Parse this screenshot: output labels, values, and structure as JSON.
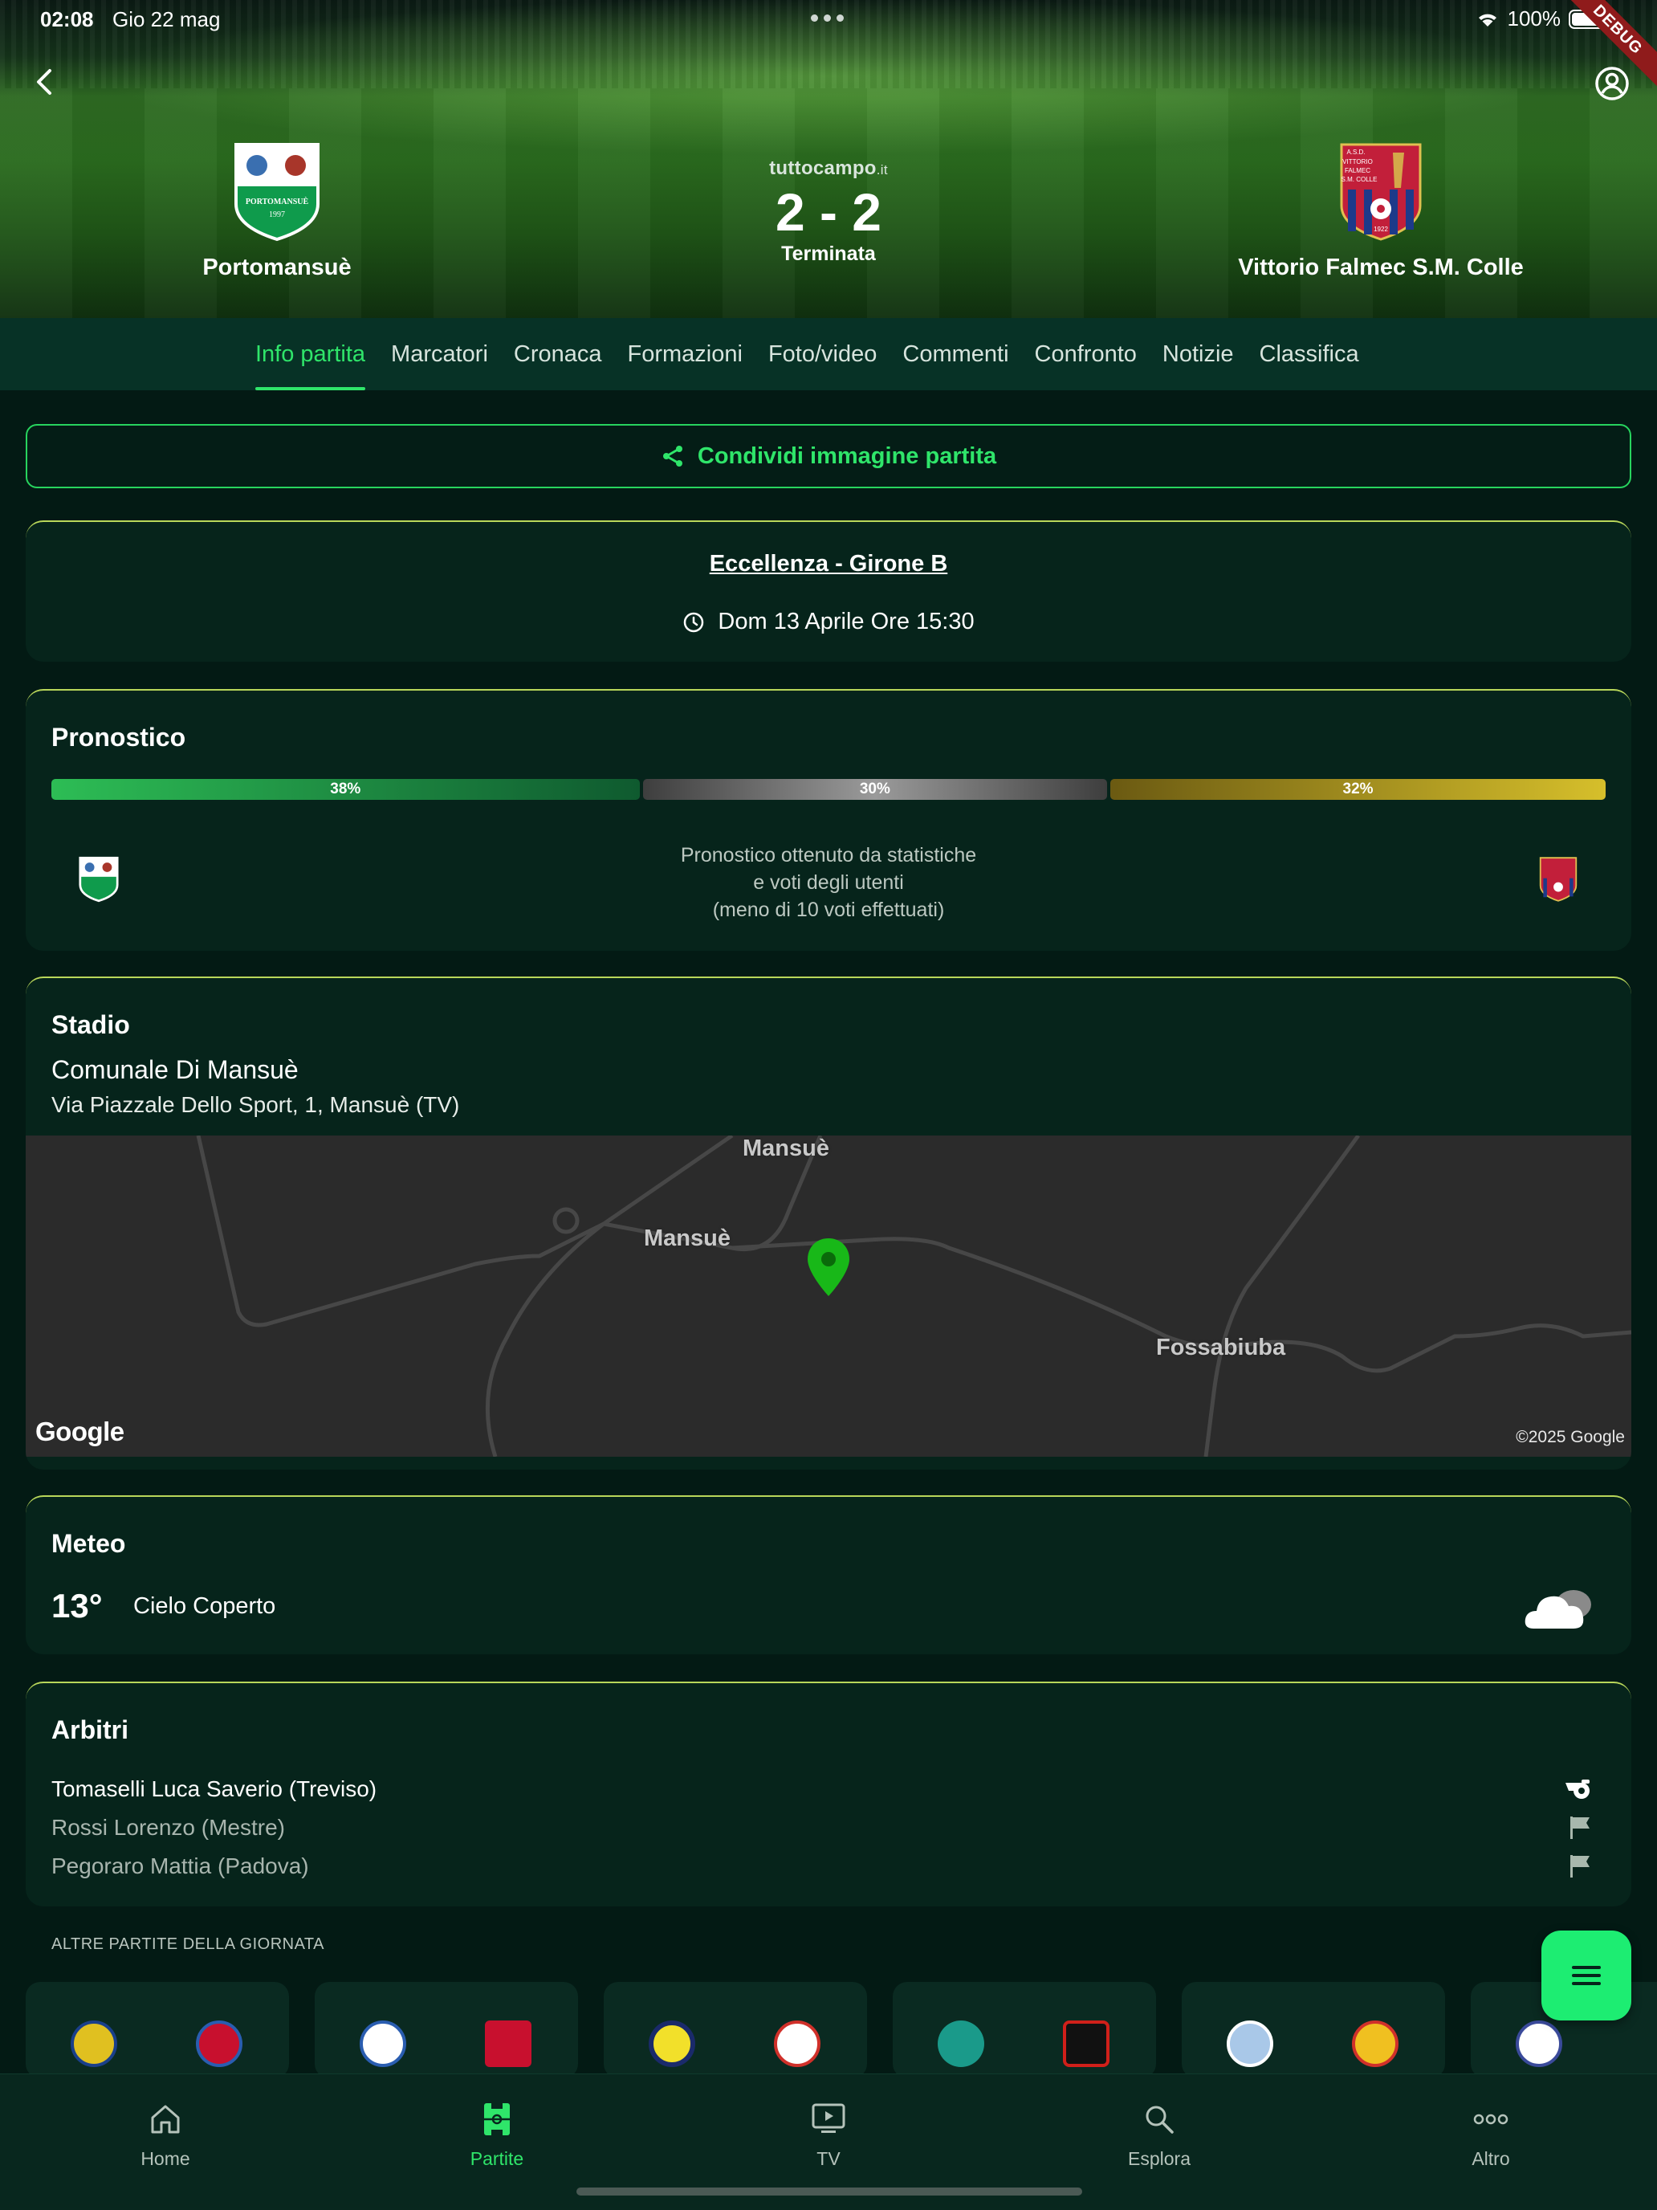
{
  "status_bar": {
    "time": "02:08",
    "date": "Gio 22 mag",
    "battery": "100%",
    "debug_ribbon": "DEBUG"
  },
  "match": {
    "brand": "tuttocampo",
    "brand_suffix": ".it",
    "score": "2 - 2",
    "status": "Terminata",
    "home_team": "Portomansuè",
    "away_team": "Vittorio Falmec S.M. Colle",
    "home_logo_text": [
      "PORTOMANSUÈ",
      "1997"
    ],
    "away_logo_text": [
      "A.S.D.",
      "VITTORIO",
      "FALMEC",
      "S.M. COLLE",
      "1922"
    ]
  },
  "tabs": [
    "Info partita",
    "Marcatori",
    "Cronaca",
    "Formazioni",
    "Foto/video",
    "Commenti",
    "Confronto",
    "Notizie",
    "Classifica"
  ],
  "active_tab": "Info partita",
  "share_button": "Condividi immagine partita",
  "league": {
    "name": "Eccellenza - Girone B",
    "datetime": "Dom 13 Aprile Ore 15:30"
  },
  "prediction": {
    "title": "Pronostico",
    "home_pct": 38,
    "draw_pct": 30,
    "away_pct": 32,
    "home_label": "38%",
    "draw_label": "30%",
    "away_label": "32%",
    "note_line1": "Pronostico ottenuto da statistiche",
    "note_line2": "e voti degli utenti",
    "note_line3": "(meno di 10 voti effettuati)"
  },
  "stadium": {
    "title": "Stadio",
    "name": "Comunale Di Mansuè",
    "address": "Via Piazzale Dello Sport, 1, Mansuè (TV)",
    "map_labels": [
      "Mansuè",
      "Mansuè",
      "Fossabiuba"
    ],
    "map_provider": "Google",
    "map_copyright": "©2025 Google"
  },
  "weather": {
    "title": "Meteo",
    "temperature": "13°",
    "description": "Cielo Coperto",
    "icon": "cloud-icon"
  },
  "referees": {
    "title": "Arbitri",
    "list": [
      {
        "name": "Tomaselli Luca Saverio (Treviso)",
        "role_icon": "whistle-icon"
      },
      {
        "name": "Rossi Lorenzo (Mestre)",
        "role_icon": "flag-icon"
      },
      {
        "name": "Pegoraro Mattia (Padova)",
        "role_icon": "flag-icon"
      }
    ]
  },
  "other_matches": {
    "title": "ALTRE PARTITE DELLA GIORNATA"
  },
  "bottom_nav": [
    {
      "label": "Home",
      "icon": "home-icon"
    },
    {
      "label": "Partite",
      "icon": "pitch-icon"
    },
    {
      "label": "TV",
      "icon": "tv-icon"
    },
    {
      "label": "Esplora",
      "icon": "search-icon"
    },
    {
      "label": "Altro",
      "icon": "more-icon"
    }
  ],
  "colors": {
    "accent": "#2fe56a",
    "background": "#031a14",
    "card": "#06241b",
    "tab_bar": "#073226"
  }
}
